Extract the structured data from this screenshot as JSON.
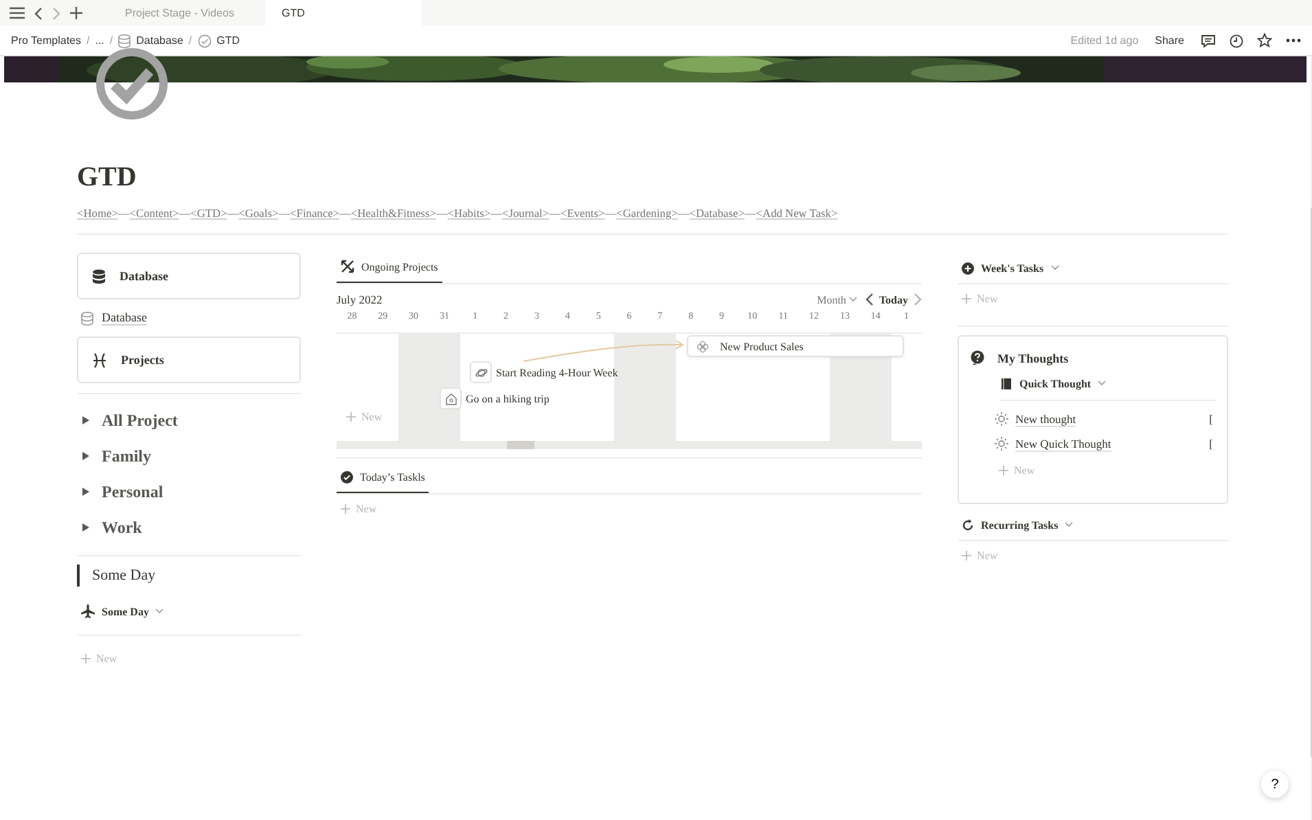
{
  "app_tabs": [
    {
      "label": "Project Stage - Videos",
      "selected": false
    },
    {
      "label": "GTD",
      "selected": true
    }
  ],
  "breadcrumb": {
    "separator": "/",
    "items": [
      {
        "label": "Pro Templates"
      },
      {
        "label": "..."
      },
      {
        "label": "Database"
      },
      {
        "label": "GTD"
      }
    ]
  },
  "topbar": {
    "edited": "Edited 1d ago",
    "share": "Share"
  },
  "page": {
    "title": "GTD",
    "joiner": "—",
    "nav": [
      "<Home>",
      "<Content>",
      "<GTD>",
      "<Goals>",
      "<Finance>",
      "<Health&Fitness>",
      "<Habits>",
      "<Journal>",
      "<Events>",
      "<Gardening>",
      "<Database>",
      "<Add New Task>"
    ]
  },
  "left": {
    "blocks": [
      {
        "kind": "card",
        "label": "Database"
      },
      {
        "kind": "link",
        "label": "Database"
      },
      {
        "kind": "card",
        "label": "Projects"
      }
    ],
    "toggles": [
      {
        "label": "All Project",
        "expanded": false
      },
      {
        "label": "Family",
        "expanded": false
      },
      {
        "label": "Personal",
        "expanded": false
      },
      {
        "label": "Work",
        "expanded": false
      }
    ],
    "quote": "Some Day",
    "view": {
      "title": "Some Day",
      "new": "New"
    }
  },
  "ongoing": {
    "tab": {
      "label": "Ongoing Projects",
      "selected": true
    },
    "month": "July 2022",
    "view": "Month",
    "today": "Today",
    "new": "New",
    "dates": [
      {
        "label": "28",
        "weekend": false
      },
      {
        "label": "29",
        "weekend": false
      },
      {
        "label": "30",
        "weekend": true
      },
      {
        "label": "31",
        "weekend": true
      },
      {
        "label": "1",
        "weekend": false
      },
      {
        "label": "2",
        "weekend": false
      },
      {
        "label": "3",
        "weekend": false
      },
      {
        "label": "4",
        "weekend": false
      },
      {
        "label": "5",
        "weekend": false
      },
      {
        "label": "6",
        "weekend": true
      },
      {
        "label": "7",
        "weekend": true
      },
      {
        "label": "8",
        "weekend": false
      },
      {
        "label": "9",
        "weekend": false
      },
      {
        "label": "10",
        "weekend": false
      },
      {
        "label": "11",
        "weekend": false
      },
      {
        "label": "12",
        "weekend": false
      },
      {
        "label": "13",
        "weekend": true
      },
      {
        "label": "14",
        "weekend": true
      },
      {
        "label": "1",
        "weekend": false
      }
    ],
    "items": [
      {
        "title": "New Product Sales",
        "kind": "bar"
      },
      {
        "title": "Start Reading 4-Hour Week",
        "kind": "point"
      },
      {
        "title": "Go on a hiking trip",
        "kind": "point"
      }
    ]
  },
  "today": {
    "tab": {
      "label": "Today’s Taskls",
      "selected": true
    },
    "new": "New"
  },
  "week": {
    "title": "Week's Tasks",
    "new": "New"
  },
  "thoughts": {
    "title": "My Thoughts",
    "view": "Quick Thought",
    "new": "New",
    "items": [
      {
        "title": "New thought",
        "column_2": "["
      },
      {
        "title": "New Quick Thought",
        "column_2": "["
      }
    ]
  },
  "recurring": {
    "title": "Recurring Tasks",
    "new": "New"
  },
  "help": "?"
}
